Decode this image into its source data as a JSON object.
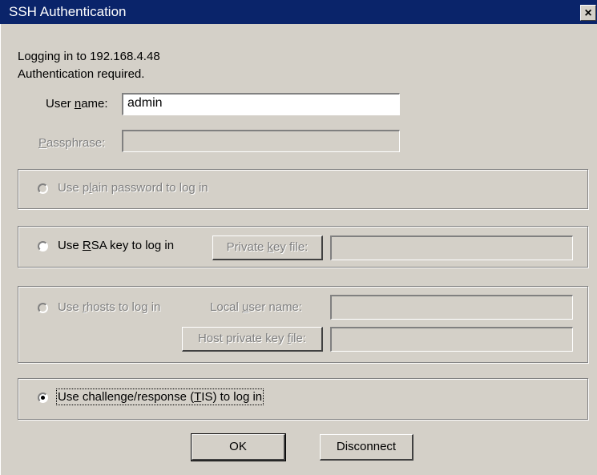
{
  "window": {
    "title": "SSH Authentication",
    "close_glyph": "×"
  },
  "info": {
    "line1": "Logging in to 192.168.4.48",
    "line2": "Authentication required."
  },
  "username": {
    "label_pre": "User ",
    "label_key": "n",
    "label_post": "ame:",
    "value": "admin"
  },
  "passphrase": {
    "label_key": "P",
    "label_post": "assphrase:",
    "value": ""
  },
  "options": {
    "plain": {
      "pre": "Use p",
      "key": "l",
      "post": "ain password to log in",
      "enabled": false,
      "selected": false
    },
    "rsa": {
      "pre": "Use ",
      "key": "R",
      "post": "SA key to log in",
      "enabled": true,
      "selected": false,
      "button_pre": "Private ",
      "button_key": "k",
      "button_post": "ey file:",
      "file_value": ""
    },
    "rhosts": {
      "pre": "Use ",
      "key": "r",
      "post": "hosts to log in",
      "enabled": false,
      "selected": false,
      "user_label_pre": "Local ",
      "user_label_key": "u",
      "user_label_post": "ser name:",
      "user_value": "",
      "button_pre": "Host private key ",
      "button_key": "f",
      "button_post": "ile:",
      "file_value": ""
    },
    "tis": {
      "pre": "Use challenge/response (",
      "key": "T",
      "post": "IS) to log in",
      "enabled": true,
      "selected": true
    }
  },
  "buttons": {
    "ok": "OK",
    "disconnect": "Disconnect"
  },
  "colors": {
    "titlebar": "#0a246a",
    "dialog": "#d4d0c8",
    "disabled_text": "#808080"
  }
}
